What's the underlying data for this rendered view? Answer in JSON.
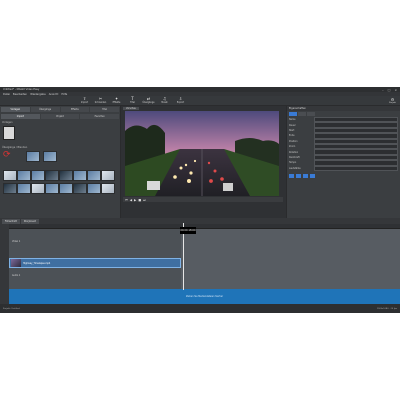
{
  "window": {
    "title": "Untitled* - MAGIX Video Easy"
  },
  "menu": [
    "Datei",
    "Bearbeiten",
    "Wiedergabe",
    "Ansicht",
    "Hilfe"
  ],
  "toolbar": {
    "buttons": [
      {
        "label": "Import",
        "icon": "import-icon"
      },
      {
        "label": "Schneiden",
        "icon": "scissors-icon"
      },
      {
        "label": "Effekte",
        "icon": "effects-icon"
      },
      {
        "label": "Titel",
        "icon": "title-icon"
      },
      {
        "label": "Übergänge",
        "icon": "transition-icon"
      },
      {
        "label": "Musik",
        "icon": "music-icon"
      },
      {
        "label": "Export",
        "icon": "export-icon"
      }
    ],
    "right_label": "Projekt"
  },
  "media": {
    "tabs": [
      "Vorlagen",
      "Übergänge",
      "Effekte",
      "Titel"
    ],
    "subtabs": [
      "Import",
      "Projekt",
      "Favoriten"
    ],
    "section1": "Vorlagen",
    "section2": "Übergänge / Blenden"
  },
  "preview": {
    "tab": "Vorschau",
    "controls": [
      "⏮",
      "◀",
      "▶",
      "■",
      "⏭"
    ]
  },
  "props": {
    "title": "Eigenschaften",
    "fields": [
      "Name",
      "Dauer",
      "Start",
      "Ende",
      "Position",
      "Zoom",
      "Rotation",
      "Deckkraft",
      "Tempo",
      "Lautstärke"
    ]
  },
  "timeline": {
    "tabs": [
      "Filmschnitt",
      "Storyboard"
    ],
    "playhead_tag": "00:00:18:00",
    "track_labels": [
      "Video 1",
      "Audio 1"
    ],
    "clip_label": "Highway_Timelapse.mp4",
    "drop_hint": "Ziehen Sie Mediendateien hierher"
  },
  "status": {
    "left": "Projekt: Untitled",
    "right": "1920x1080 · 25 fps"
  }
}
